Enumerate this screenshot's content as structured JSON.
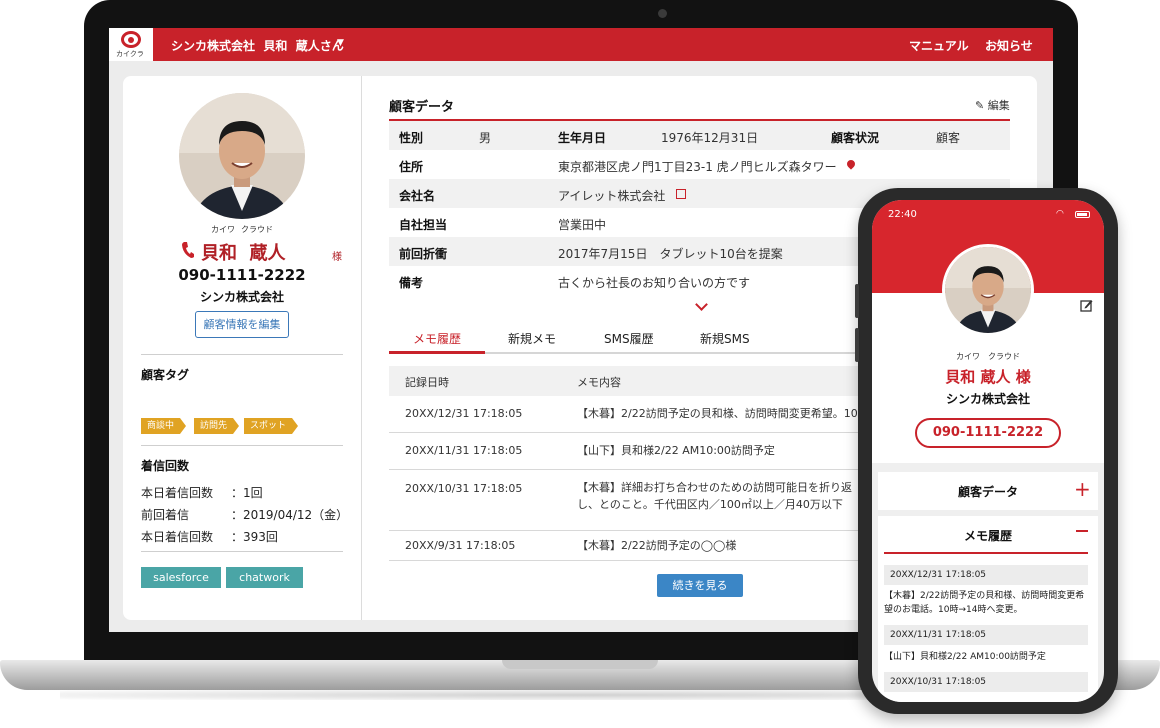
{
  "app": {
    "logo_text": "カイクラ",
    "user_label": "シンカ株式会社  貝和  蔵人さん",
    "nav": {
      "manual": "マニュアル",
      "notice": "お知らせ"
    }
  },
  "profile": {
    "kana_last": "カイワ",
    "kana_first": "クラウド",
    "name": "貝和  蔵人",
    "honorific": "様",
    "phone": "090-1111-2222",
    "company": "シンカ株式会社",
    "edit_button": "顧客情報を編集",
    "tags_title": "顧客タグ",
    "edit_label": "編集",
    "tags": [
      "商談中",
      "訪問先",
      "スポット"
    ],
    "calls_title": "着信回数",
    "stats": [
      {
        "label": "本日着信回数",
        "value": "：1回"
      },
      {
        "label": "前回着信",
        "value": "：2019/04/12（金）"
      },
      {
        "label": "本日着信回数",
        "value": "：393回"
      }
    ],
    "integrations": [
      "salesforce",
      "chatwork"
    ]
  },
  "customer_data": {
    "title": "顧客データ",
    "edit_label": "編集",
    "gender_label": "性別",
    "gender": "男",
    "birthday_label": "生年月日",
    "birthday": "1976年12月31日",
    "status_label": "顧客状況",
    "status": "顧客",
    "address_label": "住所",
    "address": "東京都港区虎ノ門1丁目23-1 虎ノ門ヒルズ森タワー",
    "company_label": "会社名",
    "company": "アイレット株式会社",
    "owner_label": "自社担当",
    "owner": "営業田中",
    "last_deal_label": "前回折衝",
    "last_deal": "2017年7月15日　タブレット10台を提案",
    "notes_label": "備考",
    "notes": "古くから社長のお知り合いの方です"
  },
  "tabs": [
    "メモ履歴",
    "新規メモ",
    "SMS履歴",
    "新規SMS"
  ],
  "memo_table": {
    "col_date": "記録日時",
    "col_content": "メモ内容",
    "rows": [
      {
        "date": "20XX/12/31 17:18:05",
        "text": "【木暮】2/22訪問予定の貝和様、訪問時間変更希望。10時→"
      },
      {
        "date": "20XX/11/31 17:18:05",
        "text": "【山下】貝和様2/22 AM10:00訪問予定"
      },
      {
        "date": "20XX/10/31 17:18:05",
        "text": "【木暮】詳細お打ち合わせのための訪問可能日を折り返し、とのこと。千代田区内／100㎡以上／月40万以下"
      },
      {
        "date": "20XX/9/31 17:18:05",
        "text": "【木暮】2/22訪問予定の◯◯様"
      }
    ],
    "more_button": "続きを見る"
  },
  "mobile": {
    "time": "22:40",
    "kana": "カイワ　クラウド",
    "name": "貝和 蔵人 様",
    "company": "シンカ株式会社",
    "phone": "090-1111-2222",
    "customer_data_title": "顧客データ",
    "memo_title": "メモ履歴",
    "memos": [
      {
        "date": "20XX/12/31 17:18:05",
        "text": "【木暮】2/22訪問予定の貝和様、訪問時間変更希望のお電話。10時→14時へ変更。"
      },
      {
        "date": "20XX/11/31 17:18:05",
        "text": "【山下】貝和様2/22 AM10:00訪問予定"
      },
      {
        "date": "20XX/10/31 17:18:05",
        "text": ""
      }
    ]
  },
  "colors": {
    "brand_red": "#c8222a",
    "link_blue": "#3b78b8",
    "tag_orange": "#e0a323",
    "integration_teal": "#4aa5a6"
  }
}
